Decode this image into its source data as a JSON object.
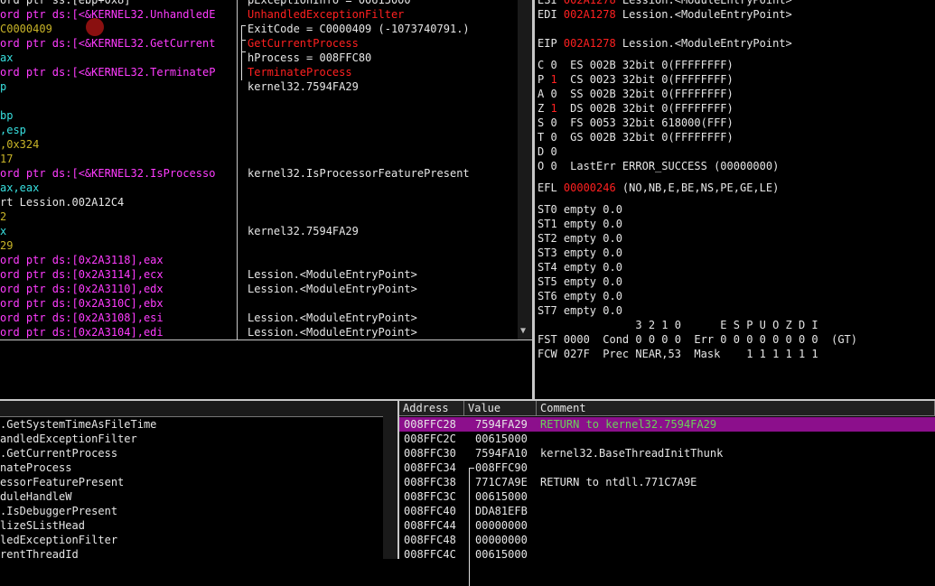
{
  "disasm": [
    {
      "text": "ord ptr ss:[ebp+0x8]",
      "cls": "w"
    },
    {
      "text": "ord ptr ds:[<&KERNEL32.UnhandledE",
      "cls": "m"
    },
    {
      "text": "C0000409",
      "cls": "y"
    },
    {
      "text": "ord ptr ds:[<&KERNEL32.GetCurrent",
      "cls": "m"
    },
    {
      "text": "ax",
      "cls": "c"
    },
    {
      "text": "ord ptr ds:[<&KERNEL32.TerminateP",
      "cls": "m"
    },
    {
      "text": "p",
      "cls": "c"
    },
    {
      "text": "",
      "cls": "w"
    },
    {
      "text": "bp",
      "cls": "c"
    },
    {
      "text": ",esp",
      "cls": "c"
    },
    {
      "text": ",0x324",
      "cls": "y"
    },
    {
      "text": "17",
      "cls": "y"
    },
    {
      "text": "ord ptr ds:[<&KERNEL32.IsProcesso",
      "cls": "m"
    },
    {
      "text": "ax,eax",
      "cls": "c"
    },
    {
      "text": "rt Lession.002A12C4",
      "cls": "w"
    },
    {
      "text": "2",
      "cls": "y"
    },
    {
      "text": "x",
      "cls": "c"
    },
    {
      "text": "29",
      "cls": "y"
    },
    {
      "text": "ord ptr ds:[0x2A3118],eax",
      "cls": "m"
    },
    {
      "text": "ord ptr ds:[0x2A3114],ecx",
      "cls": "m"
    },
    {
      "text": "ord ptr ds:[0x2A3110],edx",
      "cls": "m"
    },
    {
      "text": "ord ptr ds:[0x2A310C],ebx",
      "cls": "m"
    },
    {
      "text": "ord ptr ds:[0x2A3108],esi",
      "cls": "m"
    },
    {
      "text": "ord ptr ds:[0x2A3104],edi",
      "cls": "m"
    }
  ],
  "comments": [
    {
      "text": "pExceptionInfo = 00615000",
      "cls": "w"
    },
    {
      "text": "UnhandledExceptionFilter",
      "cls": "r"
    },
    {
      "text": "ExitCode = C0000409 (-1073740791.)",
      "cls": "w"
    },
    {
      "text": "GetCurrentProcess",
      "cls": "r"
    },
    {
      "text": "hProcess = 008FFC80",
      "cls": "w"
    },
    {
      "text": "TerminateProcess",
      "cls": "r"
    },
    {
      "text": "kernel32.7594FA29",
      "cls": "w"
    },
    {
      "text": "",
      "cls": "w"
    },
    {
      "text": "",
      "cls": "w"
    },
    {
      "text": "",
      "cls": "w"
    },
    {
      "text": "",
      "cls": "w"
    },
    {
      "text": "",
      "cls": "w"
    },
    {
      "text": "kernel32.IsProcessorFeaturePresent",
      "cls": "w"
    },
    {
      "text": "",
      "cls": "w"
    },
    {
      "text": "",
      "cls": "w"
    },
    {
      "text": "",
      "cls": "w"
    },
    {
      "text": "kernel32.7594FA29",
      "cls": "w"
    },
    {
      "text": "",
      "cls": "w"
    },
    {
      "text": "",
      "cls": "w"
    },
    {
      "text": "Lession.<ModuleEntryPoint>",
      "cls": "w"
    },
    {
      "text": "Lession.<ModuleEntryPoint>",
      "cls": "w"
    },
    {
      "text": "",
      "cls": "w"
    },
    {
      "text": "Lession.<ModuleEntryPoint>",
      "cls": "w"
    },
    {
      "text": "Lession.<ModuleEntryPoint>",
      "cls": "w"
    }
  ],
  "registers": {
    "top": [
      {
        "name": "ESI",
        "val": "002A1278",
        "rest": " Lession.<ModuleEntryPoint>"
      },
      {
        "name": "EDI",
        "val": "002A1278",
        "rest": " Lession.<ModuleEntryPoint>"
      },
      {
        "name": "",
        "val": "",
        "rest": ""
      },
      {
        "name": "EIP",
        "val": "002A1278",
        "rest": " Lession.<ModuleEntryPoint>"
      }
    ],
    "flags": [
      {
        "f": "C",
        "v": "0",
        "red": false,
        "seg": "ES 002B 32bit 0(FFFFFFFF)"
      },
      {
        "f": "P",
        "v": "1",
        "red": true,
        "seg": "CS 0023 32bit 0(FFFFFFFF)"
      },
      {
        "f": "A",
        "v": "0",
        "red": false,
        "seg": "SS 002B 32bit 0(FFFFFFFF)"
      },
      {
        "f": "Z",
        "v": "1",
        "red": true,
        "seg": "DS 002B 32bit 0(FFFFFFFF)"
      },
      {
        "f": "S",
        "v": "0",
        "red": false,
        "seg": "FS 0053 32bit 618000(FFF)"
      },
      {
        "f": "T",
        "v": "0",
        "red": false,
        "seg": "GS 002B 32bit 0(FFFFFFFF)"
      },
      {
        "f": "D",
        "v": "0",
        "red": false,
        "seg": ""
      },
      {
        "f": "O",
        "v": "0",
        "red": false,
        "seg": "LastErr ERROR_SUCCESS (00000000)"
      }
    ],
    "efl_label": "EFL",
    "efl_val": "00000246",
    "efl_rest": " (NO,NB,E,BE,NS,PE,GE,LE)",
    "st": [
      "ST0 empty 0.0",
      "ST1 empty 0.0",
      "ST2 empty 0.0",
      "ST3 empty 0.0",
      "ST4 empty 0.0",
      "ST5 empty 0.0",
      "ST6 empty 0.0",
      "ST7 empty 0.0"
    ],
    "fpu_hdr": "               3 2 1 0      E S P U O Z D I",
    "fst": "FST 0000  Cond 0 0 0 0  Err 0 0 0 0 0 0 0 0  (GT)",
    "fcw": "FCW 027F  Prec NEAR,53  Mask    1 1 1 1 1 1"
  },
  "names": [
    ".GetSystemTimeAsFileTime",
    "andledExceptionFilter",
    ".GetCurrentProcess",
    "nateProcess",
    "essorFeaturePresent",
    "duleHandleW",
    ".IsDebuggerPresent",
    "lizeSListHead",
    "ledExceptionFilter",
    "rentThreadId"
  ],
  "stack": {
    "headers": {
      "address": "Address",
      "value": "Value",
      "comment": "Comment"
    },
    "rows": [
      {
        "addr": "008FFC28",
        "val": "7594FA29",
        "cmt": "RETURN to kernel32.7594FA29",
        "sel": true
      },
      {
        "addr": "008FFC2C",
        "val": "00615000",
        "cmt": "",
        "sel": false
      },
      {
        "addr": "008FFC30",
        "val": "7594FA10",
        "cmt": "kernel32.BaseThreadInitThunk",
        "sel": false
      },
      {
        "addr": "008FFC34",
        "val": "008FFC90",
        "cmt": "",
        "sel": false
      },
      {
        "addr": "008FFC38",
        "val": "771C7A9E",
        "cmt": "RETURN to ntdll.771C7A9E",
        "sel": false
      },
      {
        "addr": "008FFC3C",
        "val": "00615000",
        "cmt": "",
        "sel": false
      },
      {
        "addr": "008FFC40",
        "val": "DDA81EFB",
        "cmt": "",
        "sel": false
      },
      {
        "addr": "008FFC44",
        "val": "00000000",
        "cmt": "",
        "sel": false
      },
      {
        "addr": "008FFC48",
        "val": "00000000",
        "cmt": "",
        "sel": false
      },
      {
        "addr": "008FFC4C",
        "val": "00615000",
        "cmt": "",
        "sel": false
      }
    ]
  }
}
